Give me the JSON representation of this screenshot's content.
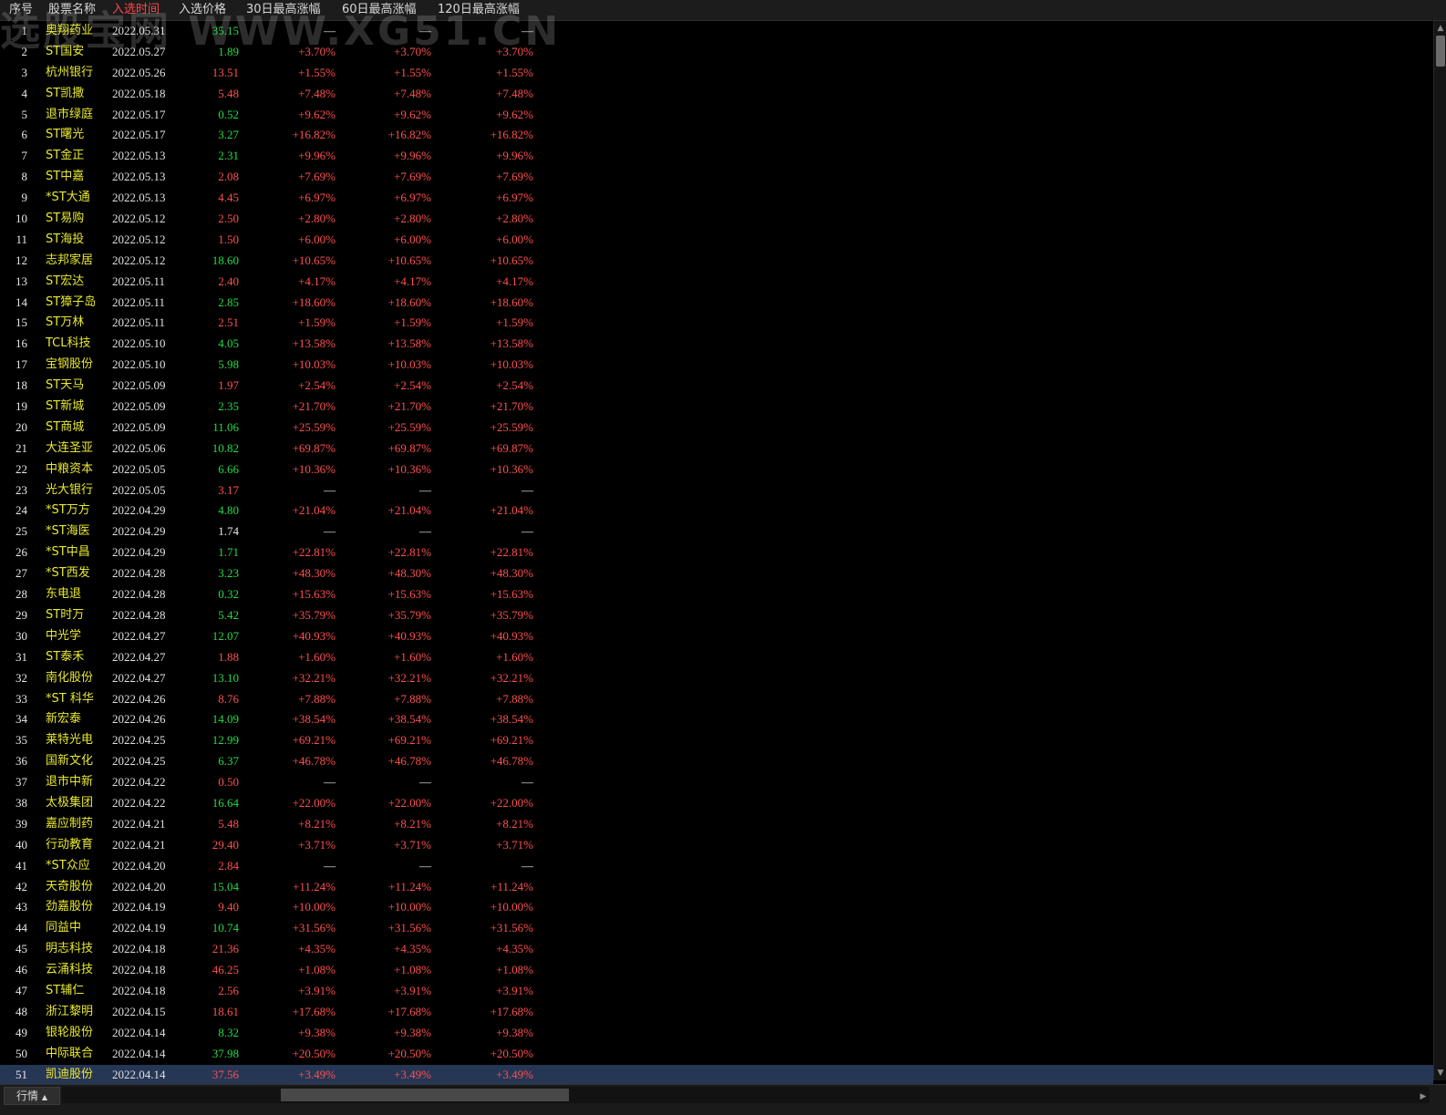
{
  "header": {
    "columns": [
      "序号",
      "股票名称",
      "入选时间",
      "入选价格",
      "30日最高涨幅",
      "60日最高涨幅",
      "120日最高涨幅"
    ],
    "watermark": "选股宝网 WWW.XG51.CN"
  },
  "colors": {
    "up": "#ff5050",
    "down": "#22dd44",
    "neutral": "#e8e8e8",
    "name": "#e8e830",
    "selected_row": "#263655"
  },
  "rows": [
    {
      "seq": "1",
      "name": "奥翔药业",
      "time": "2022.05.31",
      "price": "35.15",
      "price_trend": "down",
      "g30": "—",
      "g60": "—",
      "g120": "—"
    },
    {
      "seq": "2",
      "name": "ST国安",
      "time": "2022.05.27",
      "price": "1.89",
      "price_trend": "down",
      "g30": "+3.70%",
      "g60": "+3.70%",
      "g120": "+3.70%"
    },
    {
      "seq": "3",
      "name": "杭州银行",
      "time": "2022.05.26",
      "price": "13.51",
      "price_trend": "up",
      "g30": "+1.55%",
      "g60": "+1.55%",
      "g120": "+1.55%"
    },
    {
      "seq": "4",
      "name": "ST凯撒",
      "time": "2022.05.18",
      "price": "5.48",
      "price_trend": "up",
      "g30": "+7.48%",
      "g60": "+7.48%",
      "g120": "+7.48%"
    },
    {
      "seq": "5",
      "name": "退市绿庭",
      "time": "2022.05.17",
      "price": "0.52",
      "price_trend": "down",
      "g30": "+9.62%",
      "g60": "+9.62%",
      "g120": "+9.62%"
    },
    {
      "seq": "6",
      "name": "ST曙光",
      "time": "2022.05.17",
      "price": "3.27",
      "price_trend": "down",
      "g30": "+16.82%",
      "g60": "+16.82%",
      "g120": "+16.82%"
    },
    {
      "seq": "7",
      "name": "ST金正",
      "time": "2022.05.13",
      "price": "2.31",
      "price_trend": "down",
      "g30": "+9.96%",
      "g60": "+9.96%",
      "g120": "+9.96%"
    },
    {
      "seq": "8",
      "name": "ST中嘉",
      "time": "2022.05.13",
      "price": "2.08",
      "price_trend": "up",
      "g30": "+7.69%",
      "g60": "+7.69%",
      "g120": "+7.69%"
    },
    {
      "seq": "9",
      "name": "*ST大通",
      "time": "2022.05.13",
      "price": "4.45",
      "price_trend": "up",
      "g30": "+6.97%",
      "g60": "+6.97%",
      "g120": "+6.97%"
    },
    {
      "seq": "10",
      "name": "ST易购",
      "time": "2022.05.12",
      "price": "2.50",
      "price_trend": "up",
      "g30": "+2.80%",
      "g60": "+2.80%",
      "g120": "+2.80%"
    },
    {
      "seq": "11",
      "name": "ST海投",
      "time": "2022.05.12",
      "price": "1.50",
      "price_trend": "up",
      "g30": "+6.00%",
      "g60": "+6.00%",
      "g120": "+6.00%"
    },
    {
      "seq": "12",
      "name": "志邦家居",
      "time": "2022.05.12",
      "price": "18.60",
      "price_trend": "down",
      "g30": "+10.65%",
      "g60": "+10.65%",
      "g120": "+10.65%"
    },
    {
      "seq": "13",
      "name": "ST宏达",
      "time": "2022.05.11",
      "price": "2.40",
      "price_trend": "up",
      "g30": "+4.17%",
      "g60": "+4.17%",
      "g120": "+4.17%"
    },
    {
      "seq": "14",
      "name": "ST獐子岛",
      "time": "2022.05.11",
      "price": "2.85",
      "price_trend": "down",
      "g30": "+18.60%",
      "g60": "+18.60%",
      "g120": "+18.60%"
    },
    {
      "seq": "15",
      "name": "ST万林",
      "time": "2022.05.11",
      "price": "2.51",
      "price_trend": "up",
      "g30": "+1.59%",
      "g60": "+1.59%",
      "g120": "+1.59%"
    },
    {
      "seq": "16",
      "name": "TCL科技",
      "time": "2022.05.10",
      "price": "4.05",
      "price_trend": "down",
      "g30": "+13.58%",
      "g60": "+13.58%",
      "g120": "+13.58%"
    },
    {
      "seq": "17",
      "name": "宝钢股份",
      "time": "2022.05.10",
      "price": "5.98",
      "price_trend": "down",
      "g30": "+10.03%",
      "g60": "+10.03%",
      "g120": "+10.03%"
    },
    {
      "seq": "18",
      "name": "ST天马",
      "time": "2022.05.09",
      "price": "1.97",
      "price_trend": "up",
      "g30": "+2.54%",
      "g60": "+2.54%",
      "g120": "+2.54%"
    },
    {
      "seq": "19",
      "name": "ST新城",
      "time": "2022.05.09",
      "price": "2.35",
      "price_trend": "down",
      "g30": "+21.70%",
      "g60": "+21.70%",
      "g120": "+21.70%"
    },
    {
      "seq": "20",
      "name": "ST商城",
      "time": "2022.05.09",
      "price": "11.06",
      "price_trend": "down",
      "g30": "+25.59%",
      "g60": "+25.59%",
      "g120": "+25.59%"
    },
    {
      "seq": "21",
      "name": "大连圣亚",
      "time": "2022.05.06",
      "price": "10.82",
      "price_trend": "down",
      "g30": "+69.87%",
      "g60": "+69.87%",
      "g120": "+69.87%"
    },
    {
      "seq": "22",
      "name": "中粮资本",
      "time": "2022.05.05",
      "price": "6.66",
      "price_trend": "down",
      "g30": "+10.36%",
      "g60": "+10.36%",
      "g120": "+10.36%"
    },
    {
      "seq": "23",
      "name": "光大银行",
      "time": "2022.05.05",
      "price": "3.17",
      "price_trend": "up",
      "g30": "—",
      "g60": "—",
      "g120": "—"
    },
    {
      "seq": "24",
      "name": "*ST万方",
      "time": "2022.04.29",
      "price": "4.80",
      "price_trend": "down",
      "g30": "+21.04%",
      "g60": "+21.04%",
      "g120": "+21.04%"
    },
    {
      "seq": "25",
      "name": "*ST海医",
      "time": "2022.04.29",
      "price": "1.74",
      "price_trend": "neutral",
      "g30": "—",
      "g60": "—",
      "g120": "—"
    },
    {
      "seq": "26",
      "name": "*ST中昌",
      "time": "2022.04.29",
      "price": "1.71",
      "price_trend": "down",
      "g30": "+22.81%",
      "g60": "+22.81%",
      "g120": "+22.81%"
    },
    {
      "seq": "27",
      "name": "*ST西发",
      "time": "2022.04.28",
      "price": "3.23",
      "price_trend": "down",
      "g30": "+48.30%",
      "g60": "+48.30%",
      "g120": "+48.30%"
    },
    {
      "seq": "28",
      "name": "东电退",
      "time": "2022.04.28",
      "price": "0.32",
      "price_trend": "down",
      "g30": "+15.63%",
      "g60": "+15.63%",
      "g120": "+15.63%"
    },
    {
      "seq": "29",
      "name": "ST时万",
      "time": "2022.04.28",
      "price": "5.42",
      "price_trend": "down",
      "g30": "+35.79%",
      "g60": "+35.79%",
      "g120": "+35.79%"
    },
    {
      "seq": "30",
      "name": "中光学",
      "time": "2022.04.27",
      "price": "12.07",
      "price_trend": "down",
      "g30": "+40.93%",
      "g60": "+40.93%",
      "g120": "+40.93%"
    },
    {
      "seq": "31",
      "name": "ST泰禾",
      "time": "2022.04.27",
      "price": "1.88",
      "price_trend": "up",
      "g30": "+1.60%",
      "g60": "+1.60%",
      "g120": "+1.60%"
    },
    {
      "seq": "32",
      "name": "南化股份",
      "time": "2022.04.27",
      "price": "13.10",
      "price_trend": "down",
      "g30": "+32.21%",
      "g60": "+32.21%",
      "g120": "+32.21%"
    },
    {
      "seq": "33",
      "name": "*ST 科华",
      "time": "2022.04.26",
      "price": "8.76",
      "price_trend": "up",
      "g30": "+7.88%",
      "g60": "+7.88%",
      "g120": "+7.88%"
    },
    {
      "seq": "34",
      "name": "新宏泰",
      "time": "2022.04.26",
      "price": "14.09",
      "price_trend": "down",
      "g30": "+38.54%",
      "g60": "+38.54%",
      "g120": "+38.54%"
    },
    {
      "seq": "35",
      "name": "莱特光电",
      "time": "2022.04.25",
      "price": "12.99",
      "price_trend": "down",
      "g30": "+69.21%",
      "g60": "+69.21%",
      "g120": "+69.21%"
    },
    {
      "seq": "36",
      "name": "国新文化",
      "time": "2022.04.25",
      "price": "6.37",
      "price_trend": "down",
      "g30": "+46.78%",
      "g60": "+46.78%",
      "g120": "+46.78%"
    },
    {
      "seq": "37",
      "name": "退市中新",
      "time": "2022.04.22",
      "price": "0.50",
      "price_trend": "up",
      "g30": "—",
      "g60": "—",
      "g120": "—"
    },
    {
      "seq": "38",
      "name": "太极集团",
      "time": "2022.04.22",
      "price": "16.64",
      "price_trend": "down",
      "g30": "+22.00%",
      "g60": "+22.00%",
      "g120": "+22.00%"
    },
    {
      "seq": "39",
      "name": "嘉应制药",
      "time": "2022.04.21",
      "price": "5.48",
      "price_trend": "up",
      "g30": "+8.21%",
      "g60": "+8.21%",
      "g120": "+8.21%"
    },
    {
      "seq": "40",
      "name": "行动教育",
      "time": "2022.04.21",
      "price": "29.40",
      "price_trend": "up",
      "g30": "+3.71%",
      "g60": "+3.71%",
      "g120": "+3.71%"
    },
    {
      "seq": "41",
      "name": "*ST众应",
      "time": "2022.04.20",
      "price": "2.84",
      "price_trend": "up",
      "g30": "—",
      "g60": "—",
      "g120": "—"
    },
    {
      "seq": "42",
      "name": "天奇股份",
      "time": "2022.04.20",
      "price": "15.04",
      "price_trend": "down",
      "g30": "+11.24%",
      "g60": "+11.24%",
      "g120": "+11.24%"
    },
    {
      "seq": "43",
      "name": "劲嘉股份",
      "time": "2022.04.19",
      "price": "9.40",
      "price_trend": "up",
      "g30": "+10.00%",
      "g60": "+10.00%",
      "g120": "+10.00%"
    },
    {
      "seq": "44",
      "name": "同益中",
      "time": "2022.04.19",
      "price": "10.74",
      "price_trend": "down",
      "g30": "+31.56%",
      "g60": "+31.56%",
      "g120": "+31.56%"
    },
    {
      "seq": "45",
      "name": "明志科技",
      "time": "2022.04.18",
      "price": "21.36",
      "price_trend": "up",
      "g30": "+4.35%",
      "g60": "+4.35%",
      "g120": "+4.35%"
    },
    {
      "seq": "46",
      "name": "云涌科技",
      "time": "2022.04.18",
      "price": "46.25",
      "price_trend": "up",
      "g30": "+1.08%",
      "g60": "+1.08%",
      "g120": "+1.08%"
    },
    {
      "seq": "47",
      "name": "ST辅仁",
      "time": "2022.04.18",
      "price": "2.56",
      "price_trend": "up",
      "g30": "+3.91%",
      "g60": "+3.91%",
      "g120": "+3.91%"
    },
    {
      "seq": "48",
      "name": "浙江黎明",
      "time": "2022.04.15",
      "price": "18.61",
      "price_trend": "up",
      "g30": "+17.68%",
      "g60": "+17.68%",
      "g120": "+17.68%"
    },
    {
      "seq": "49",
      "name": "银轮股份",
      "time": "2022.04.14",
      "price": "8.32",
      "price_trend": "down",
      "g30": "+9.38%",
      "g60": "+9.38%",
      "g120": "+9.38%"
    },
    {
      "seq": "50",
      "name": "中际联合",
      "time": "2022.04.14",
      "price": "37.98",
      "price_trend": "down",
      "g30": "+20.50%",
      "g60": "+20.50%",
      "g120": "+20.50%"
    },
    {
      "seq": "51",
      "name": "凯迪股份",
      "time": "2022.04.14",
      "price": "37.56",
      "price_trend": "up",
      "g30": "+3.49%",
      "g60": "+3.49%",
      "g120": "+3.49%"
    }
  ],
  "selected_index": 50,
  "footer": {
    "tab_label": "行情",
    "tab_icon": "triangle-up-icon"
  }
}
